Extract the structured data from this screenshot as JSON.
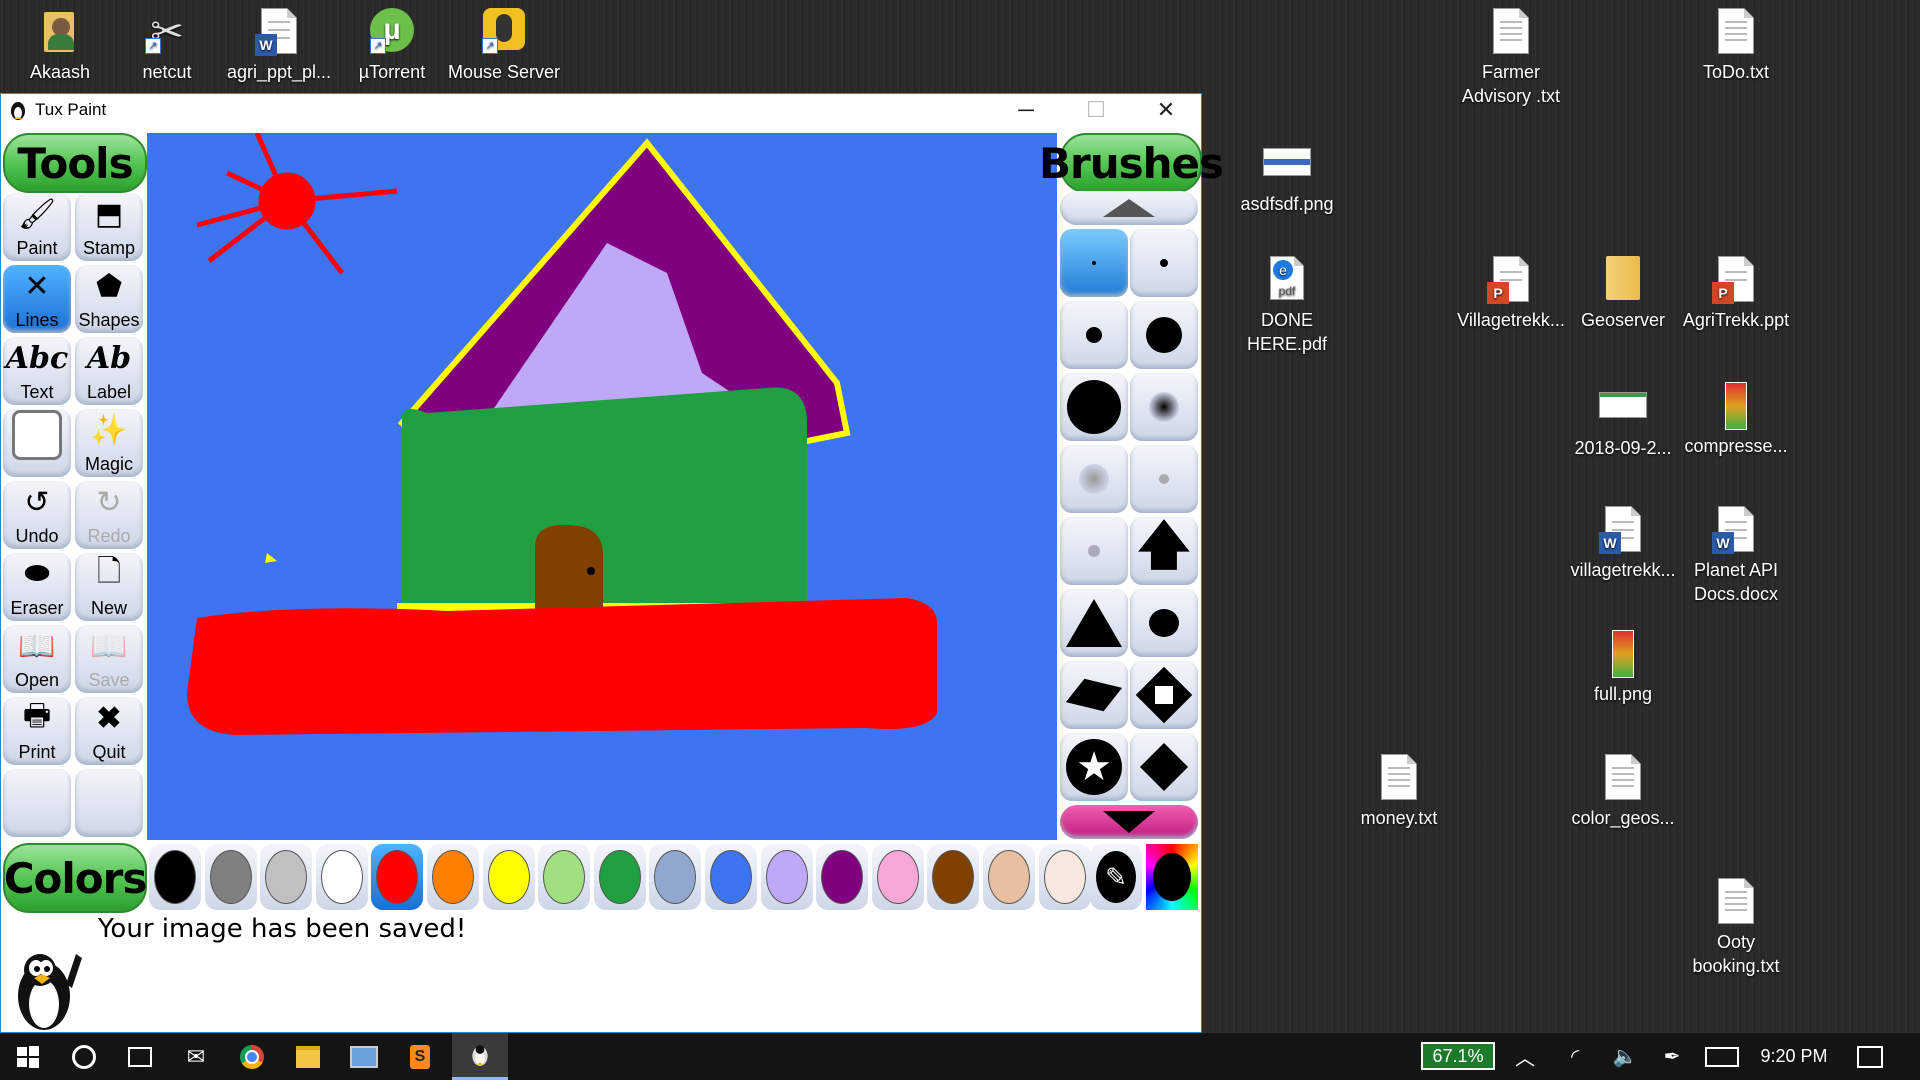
{
  "desktop": {
    "icons_top": [
      {
        "label": "Akaash",
        "icon": "user-folder-icon"
      },
      {
        "label": "netcut",
        "icon": "scissors-icon"
      },
      {
        "label": "agri_ppt_pl...",
        "icon": "word-doc-icon"
      },
      {
        "label": "µTorrent",
        "icon": "utorrent-icon"
      },
      {
        "label": "Mouse Server",
        "icon": "mouse-server-icon"
      }
    ],
    "icons_right": [
      {
        "label": "Farmer Advisory .txt",
        "icon": "text-file-icon"
      },
      {
        "label": "ToDo.txt",
        "icon": "text-file-icon"
      },
      {
        "label": "asdfsdf.png",
        "icon": "image-file-icon"
      },
      {
        "label": "DONE HERE.pdf",
        "icon": "pdf-file-icon"
      },
      {
        "label": "Villagetrekk...",
        "icon": "powerpoint-file-icon"
      },
      {
        "label": "Geoserver",
        "icon": "folder-icon"
      },
      {
        "label": "AgriTrekk.ppt",
        "icon": "powerpoint-file-icon"
      },
      {
        "label": "2018-09-2...",
        "icon": "image-file-icon"
      },
      {
        "label": "compresse...",
        "icon": "image-file-icon"
      },
      {
        "label": "villagetrekk...",
        "icon": "word-doc-icon"
      },
      {
        "label": "Planet API Docs.docx",
        "icon": "word-doc-icon"
      },
      {
        "label": "full.png",
        "icon": "image-file-icon"
      },
      {
        "label": "money.txt",
        "icon": "text-file-icon"
      },
      {
        "label": "color_geos...",
        "icon": "text-file-icon"
      },
      {
        "label": "Ooty booking.txt",
        "icon": "text-file-icon"
      }
    ]
  },
  "window": {
    "title": "Tux Paint",
    "controls": {
      "minimize": "─",
      "maximize": "☐",
      "close": "✕"
    }
  },
  "tuxpaint": {
    "tools_title": "Tools",
    "brushes_title": "Brushes",
    "colors_title": "Colors",
    "tools": [
      {
        "label": "Paint",
        "glyph": "🖌"
      },
      {
        "label": "Stamp",
        "glyph": "⬒"
      },
      {
        "label": "Lines",
        "glyph": "✕"
      },
      {
        "label": "Shapes",
        "glyph": "⬟"
      },
      {
        "label": "Text",
        "glyph": "Abc"
      },
      {
        "label": "Label",
        "glyph": "Ab"
      },
      {
        "label": "",
        "glyph": "▢"
      },
      {
        "label": "Magic",
        "glyph": "✨"
      },
      {
        "label": "Undo",
        "glyph": "↺"
      },
      {
        "label": "Redo",
        "glyph": "↻"
      },
      {
        "label": "Eraser",
        "glyph": "⬬"
      },
      {
        "label": "New",
        "glyph": "🗋"
      },
      {
        "label": "Open",
        "glyph": "📖"
      },
      {
        "label": "Save",
        "glyph": "📖"
      },
      {
        "label": "Print",
        "glyph": "🖶"
      },
      {
        "label": "Quit",
        "glyph": "✖"
      }
    ],
    "selected_tool": "Lines",
    "message": "Your image has been saved!",
    "palette": [
      "#000000",
      "#808080",
      "#c0c0c0",
      "#ffffff",
      "#ff0000",
      "#ff8000",
      "#ffff00",
      "#a0e080",
      "#20a040",
      "#90a8d0",
      "#3d74f2",
      "#c0a8f8",
      "#800080",
      "#f8a8d8",
      "#804000",
      "#e8c0a0",
      "#f8e8e0"
    ],
    "selected_color": "#ff0000"
  },
  "taskbar": {
    "battery": "67.1%",
    "time": "9:20 PM",
    "apps": [
      "start-icon",
      "cortana-icon",
      "task-view-icon",
      "mail-icon",
      "chrome-icon",
      "file-explorer-icon",
      "network-app-icon",
      "sublime-icon",
      "tuxpaint-icon"
    ]
  }
}
